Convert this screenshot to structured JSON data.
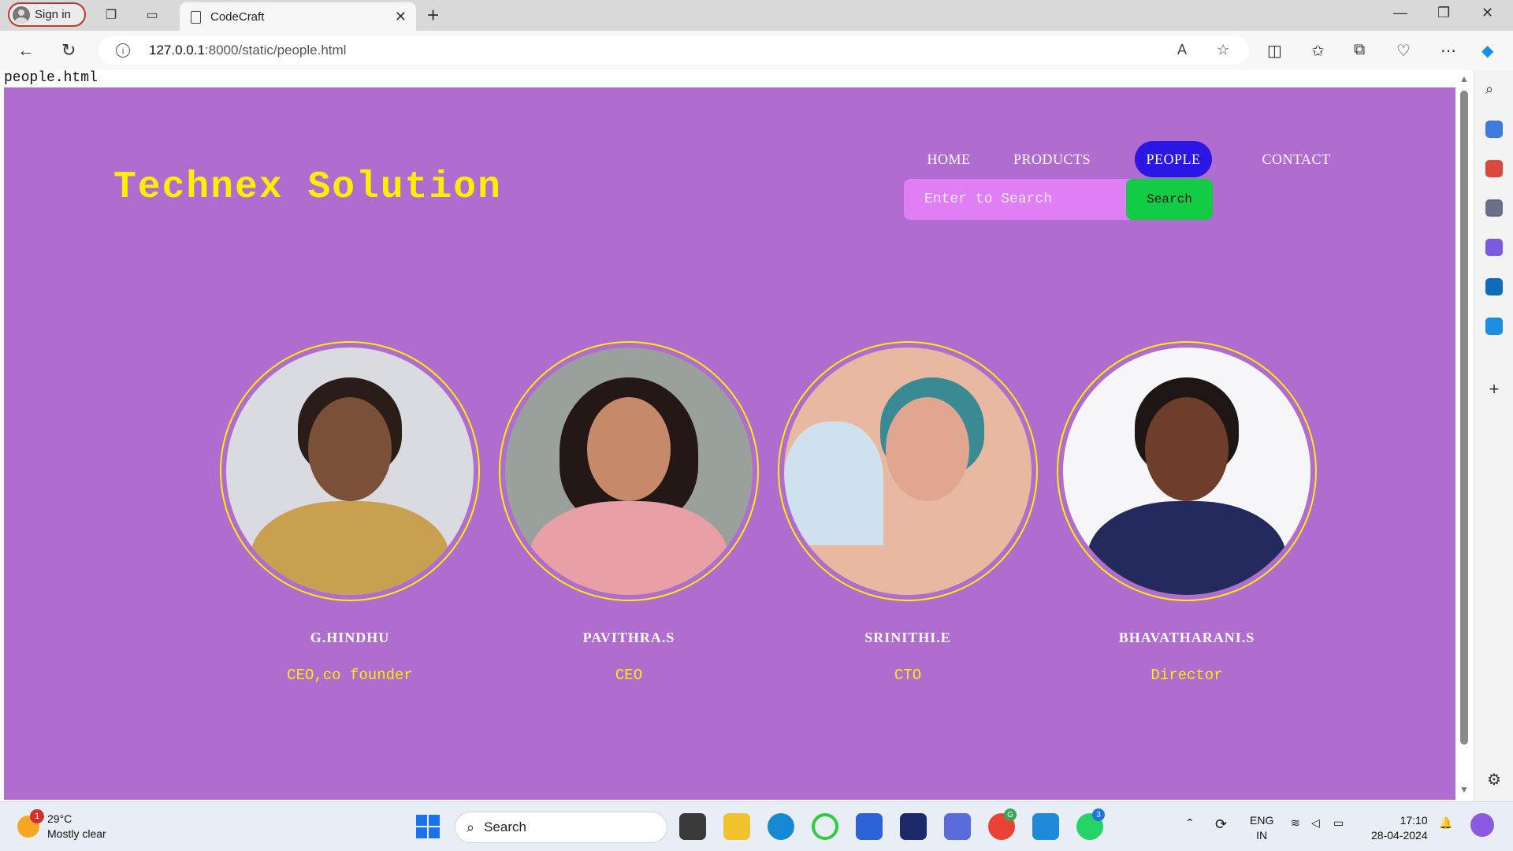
{
  "browser": {
    "signin_label": "Sign in",
    "tab_title": "CodeCraft",
    "url_host": "127.0.0.1",
    "url_path": ":8000/static/people.html"
  },
  "page": {
    "filename": "people.html",
    "brand": "Technex Solution",
    "nav": [
      {
        "label": "HOME",
        "active": false
      },
      {
        "label": "PRODUCTS",
        "active": false
      },
      {
        "label": "PEOPLE",
        "active": true
      },
      {
        "label": "CONTACT",
        "active": false
      }
    ],
    "search": {
      "placeholder": "Enter to Search",
      "button": "Search"
    },
    "people": [
      {
        "name": "G.HINDHU",
        "role": "CEO,co founder"
      },
      {
        "name": "PAVITHRA.S",
        "role": "CEO"
      },
      {
        "name": "SRINITHI.E",
        "role": "CTO"
      },
      {
        "name": "BHAVATHARANI.S",
        "role": "Director"
      }
    ]
  },
  "colors": {
    "background": "#b06ccf",
    "brand": "#ffee00",
    "active_nav": "#2b16e6",
    "search_input": "#e07ef6",
    "search_button": "#11cc44"
  },
  "taskbar": {
    "weather_temp": "29°C",
    "weather_desc": "Mostly clear",
    "weather_badge": "1",
    "search_label": "Search",
    "lang_top": "ENG",
    "lang_bottom": "IN",
    "time": "17:10",
    "date": "28-04-2024",
    "whatsapp_badge": "3",
    "chrome_badge": "G"
  }
}
